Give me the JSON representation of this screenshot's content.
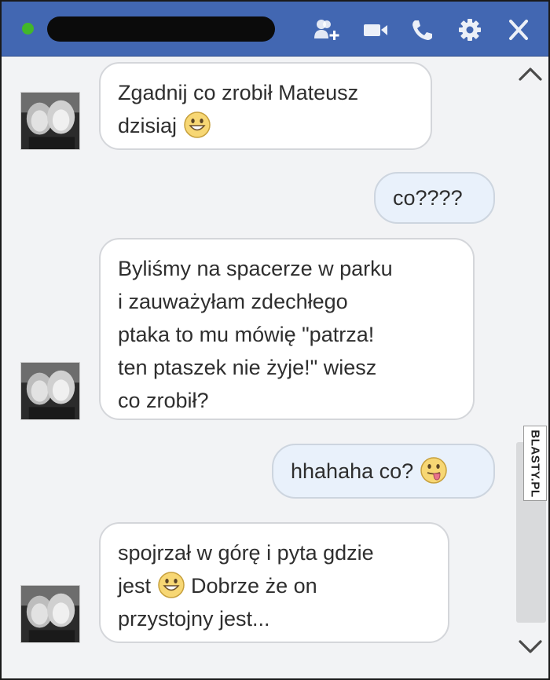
{
  "header": {
    "status": "online",
    "contact_name_redacted": true,
    "icons": [
      "add-person-icon",
      "video-camera-icon",
      "phone-icon",
      "gear-icon",
      "close-icon"
    ],
    "bar_color": "#4267b2",
    "status_color": "#42b72a"
  },
  "messages": [
    {
      "direction": "incoming",
      "lines": [
        [
          {
            "text": "Zgadnij co zrobił Mateusz"
          }
        ],
        [
          {
            "text": "dzisiaj "
          },
          {
            "emoji": "smile-emoji"
          }
        ]
      ]
    },
    {
      "direction": "outgoing",
      "lines": [
        [
          {
            "text": "co????"
          }
        ]
      ]
    },
    {
      "direction": "incoming",
      "lines": [
        [
          {
            "text": "Byliśmy na spacerze w parku"
          }
        ],
        [
          {
            "text": "i zauważyłam zdechłego"
          }
        ],
        [
          {
            "text": "ptaka to mu mówię \"patrza!"
          }
        ],
        [
          {
            "text": "ten ptaszek nie żyje!\" wiesz"
          }
        ],
        [
          {
            "text": "co zrobił?"
          }
        ]
      ]
    },
    {
      "direction": "outgoing",
      "lines": [
        [
          {
            "text": "hhahaha co? "
          },
          {
            "emoji": "tongue-emoji"
          }
        ]
      ]
    },
    {
      "direction": "incoming",
      "lines": [
        [
          {
            "text": "spojrzał w górę i pyta gdzie"
          }
        ],
        [
          {
            "text": "jest "
          },
          {
            "emoji": "smile-emoji"
          },
          {
            "text": " Dobrze że on"
          }
        ],
        [
          {
            "text": "przystojny jest..."
          }
        ]
      ]
    }
  ],
  "watermark": {
    "text": "BLASTY.PL"
  },
  "colors": {
    "incoming_bubble": "#ffffff",
    "outgoing_bubble": "#e9f1fb",
    "chat_background": "#f2f3f5"
  }
}
